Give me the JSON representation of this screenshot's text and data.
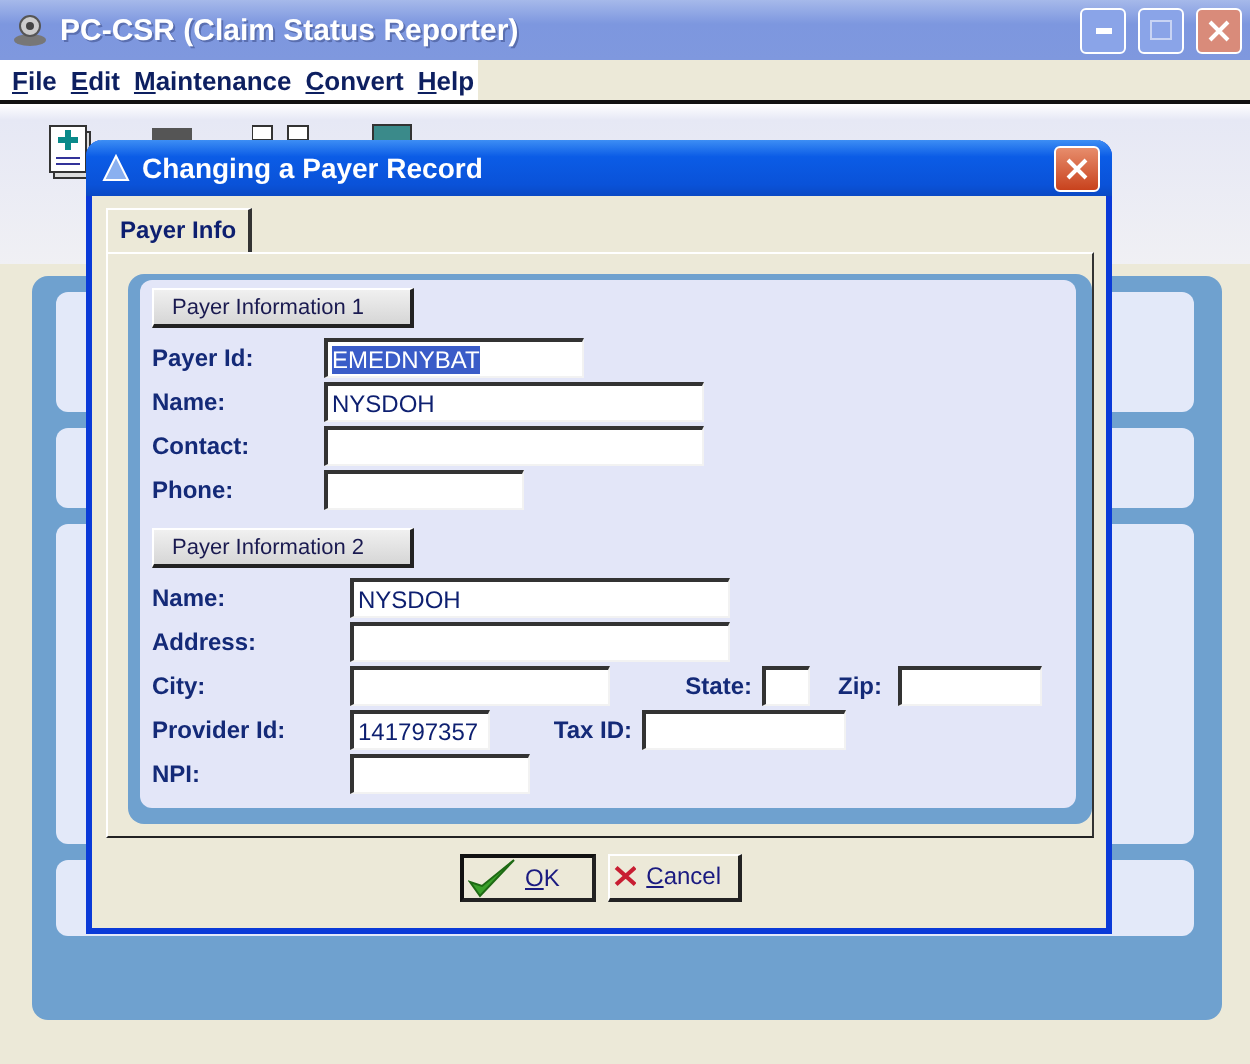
{
  "window": {
    "title": "PC-CSR (Claim Status Reporter)"
  },
  "menu": [
    {
      "label": "File"
    },
    {
      "label": "Edit"
    },
    {
      "label": "Maintenance"
    },
    {
      "label": "Convert"
    },
    {
      "label": "Help"
    }
  ],
  "dialog": {
    "title": "Changing a Payer Record",
    "tabs": [
      {
        "label": "Payer Info",
        "selected": true
      }
    ],
    "sections": [
      {
        "title": "Payer Information 1",
        "rows": [
          [
            {
              "label": "Payer Id:",
              "value": "EMEDNYBAT",
              "highlighted": true
            }
          ],
          [
            {
              "label": "Name:",
              "value": "NYSDOH",
              "highlighted": false
            }
          ],
          [
            {
              "label": "Contact:"
            }
          ],
          [
            {
              "label": "Phone:"
            }
          ]
        ]
      },
      {
        "title": "Payer Information 2",
        "rows": [
          [
            {
              "label": "Name:",
              "value": "NYSDOH",
              "highlighted": false
            }
          ],
          [
            {
              "label": "Address:"
            }
          ],
          [
            {
              "label": "City:"
            },
            {
              "label": "State:"
            },
            {
              "label": "Zip:"
            }
          ],
          [
            {
              "label": "Provider Id:",
              "value": "141797357",
              "highlighted": false
            },
            {
              "label": "Tax ID:"
            }
          ],
          [
            {
              "label": "NPI:"
            }
          ]
        ]
      }
    ],
    "buttons": [
      {
        "kind": "ok",
        "label": "OK",
        "default": true
      },
      {
        "kind": "cancel",
        "label": "Cancel",
        "default": false
      }
    ]
  }
}
